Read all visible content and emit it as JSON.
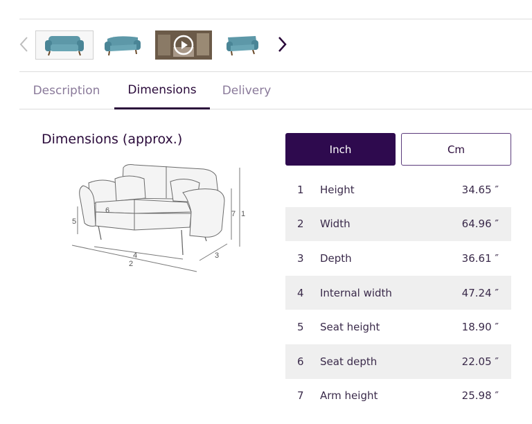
{
  "tabs": {
    "description": "Description",
    "dimensions": "Dimensions",
    "delivery": "Delivery"
  },
  "dimensions_title": "Dimensions (approx.)",
  "diagram_labels": [
    "1",
    "2",
    "3",
    "4",
    "5",
    "6",
    "7"
  ],
  "units": {
    "inch": "Inch",
    "cm": "Cm",
    "selected": "Inch"
  },
  "rows": [
    {
      "num": "1",
      "label": "Height",
      "value": "34.65 ″"
    },
    {
      "num": "2",
      "label": "Width",
      "value": "64.96 ″"
    },
    {
      "num": "3",
      "label": "Depth",
      "value": "36.61 ″"
    },
    {
      "num": "4",
      "label": "Internal width",
      "value": "47.24 ″"
    },
    {
      "num": "5",
      "label": "Seat height",
      "value": "18.90 ″"
    },
    {
      "num": "6",
      "label": "Seat depth",
      "value": "22.05 ″"
    },
    {
      "num": "7",
      "label": "Arm height",
      "value": "25.98 ″"
    }
  ],
  "colors": {
    "accent": "#2e0a4e",
    "sofa": "#4a8a9a",
    "row_alt": "#efefef"
  }
}
